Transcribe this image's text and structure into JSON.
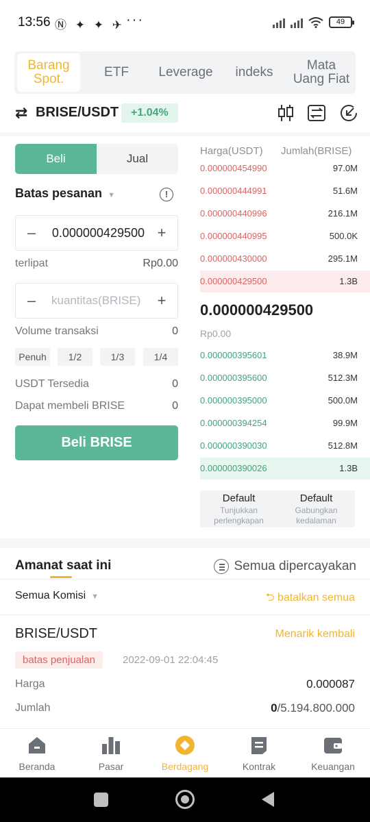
{
  "status_bar": {
    "time": "13:56",
    "notif_icons": "Ⓝ ✦ ✦ ✈",
    "dots": "···",
    "battery": "49"
  },
  "top_tabs": [
    {
      "label": "Barang Spot.",
      "active": true
    },
    {
      "label": "ETF",
      "active": false
    },
    {
      "label": "Leverage",
      "active": false
    },
    {
      "label": "indeks",
      "active": false
    },
    {
      "label": "Mata Uang Fiat",
      "active": false
    }
  ],
  "pair": {
    "name": "BRISE/USDT",
    "change": "+1.04%"
  },
  "trade": {
    "buy_label": "Beli",
    "sell_label": "Jual",
    "order_type": "Batas pesanan",
    "price_value": "0.000000429500",
    "fold_label": "terlipat",
    "fold_value": "Rp0.00",
    "quantity_placeholder": "kuantitas(BRISE)",
    "volume_label": "Volume transaksi",
    "volume_value": "0",
    "pct_buttons": [
      "Penuh",
      "1/2",
      "1/3",
      "1/4"
    ],
    "usdt_label": "USDT Tersedia",
    "usdt_value": "0",
    "canbuy_label": "Dapat membeli BRISE",
    "canbuy_value": "0",
    "submit_label": "Beli BRISE"
  },
  "order_book": {
    "price_header": "Harga(USDT)",
    "qty_header": "Jumlah(BRISE)",
    "asks": [
      {
        "price": "0.000000454990",
        "qty": "97.0M"
      },
      {
        "price": "0.000000444991",
        "qty": "51.6M"
      },
      {
        "price": "0.000000440996",
        "qty": "216.1M"
      },
      {
        "price": "0.000000440995",
        "qty": "500.0K"
      },
      {
        "price": "0.000000430000",
        "qty": "295.1M"
      },
      {
        "price": "0.000000429500",
        "qty": "1.3B"
      }
    ],
    "last_price": "0.000000429500",
    "last_fiat": "Rp0.00",
    "bids": [
      {
        "price": "0.000000395601",
        "qty": "38.9M"
      },
      {
        "price": "0.000000395600",
        "qty": "512.3M"
      },
      {
        "price": "0.000000395000",
        "qty": "500.0M"
      },
      {
        "price": "0.000000394254",
        "qty": "99.9M"
      },
      {
        "price": "0.000000390030",
        "qty": "512.8M"
      },
      {
        "price": "0.000000390026",
        "qty": "1.3B"
      }
    ],
    "depth_left_title": "Default",
    "depth_left_sub": "Tunjukkan perlengkapan",
    "depth_right_title": "Default",
    "depth_right_sub": "Gabungkan kedalaman"
  },
  "orders": {
    "title": "Amanat saat ini",
    "all_trusted": "Semua dipercayakan",
    "filter": "Semua Komisi",
    "cancel_all": "batalkan semua",
    "item": {
      "pair": "BRISE/USDT",
      "withdraw": "Menarik kembali",
      "badge": "batas penjualan",
      "time": "2022-09-01 22:04:45",
      "price_label": "Harga",
      "price_value": "0.000087",
      "amount_label": "Jumlah",
      "amount_filled": "0",
      "amount_total": "/5.194.800.000"
    }
  },
  "bottom_tabs": [
    {
      "label": "Beranda",
      "icon": "home-icon",
      "active": false
    },
    {
      "label": "Pasar",
      "icon": "bar-chart-icon",
      "active": false
    },
    {
      "label": "Berdagang",
      "icon": "trade-icon",
      "active": true
    },
    {
      "label": "Kontrak",
      "icon": "contract-icon",
      "active": false
    },
    {
      "label": "Keuangan",
      "icon": "wallet-icon",
      "active": false
    }
  ],
  "colors": {
    "accent": "#f2b530",
    "buy_green": "#5bb795",
    "sell_red": "#e06060"
  }
}
